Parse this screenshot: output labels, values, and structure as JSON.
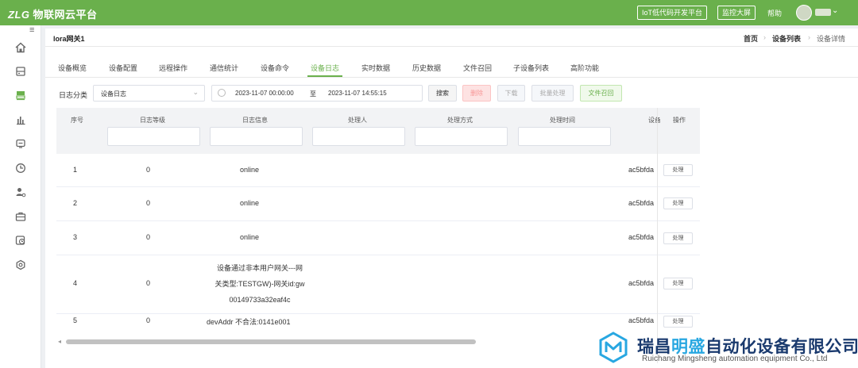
{
  "header": {
    "brand": "ZLG",
    "platform": "物联网云平台",
    "buttons": [
      "IoT低代码开发平台",
      "监控大屏"
    ],
    "help": "帮助"
  },
  "sidebar": {
    "collapse_icon": "hamburger-icon",
    "items": [
      {
        "icon": "home-icon"
      },
      {
        "icon": "device-icon"
      },
      {
        "icon": "gateway-icon",
        "active": true
      },
      {
        "icon": "bar-chart-icon"
      },
      {
        "icon": "message-icon"
      },
      {
        "icon": "clock-icon"
      },
      {
        "icon": "user-settings-icon"
      },
      {
        "icon": "briefcase-icon"
      },
      {
        "icon": "history-icon"
      },
      {
        "icon": "gear-icon"
      }
    ]
  },
  "page": {
    "title": "lora网关1",
    "breadcrumb": [
      "首页",
      "设备列表",
      "设备详情"
    ]
  },
  "tabs": [
    "设备概览",
    "设备配置",
    "远程操作",
    "通信统计",
    "设备命令",
    "设备日志",
    "实时数据",
    "历史数据",
    "文件召回",
    "子设备列表",
    "高阶功能"
  ],
  "active_tab": "设备日志",
  "filters": {
    "label": "日志分类",
    "select_value": "设备日志",
    "start": "2023-11-07 00:00:00",
    "separator": "至",
    "end": "2023-11-07 14:55:15",
    "buttons": {
      "search": "搜索",
      "delete": "删除",
      "download": "下载",
      "batch": "批量处理",
      "recall": "文件召回"
    }
  },
  "table": {
    "columns": [
      "序号",
      "日志等级",
      "日志信息",
      "处理人",
      "处理方式",
      "处理时间",
      "设备",
      "操作"
    ],
    "op_label": "处理",
    "rows": [
      {
        "index": "1",
        "level": "0",
        "info": "online",
        "device": "ac5bfda"
      },
      {
        "index": "2",
        "level": "0",
        "info": "online",
        "device": "ac5bfda"
      },
      {
        "index": "3",
        "level": "0",
        "info": "online",
        "device": "ac5bfda"
      },
      {
        "index": "4",
        "level": "0",
        "info_lines": [
          "设备通过非本用户网关---网",
          "关类型:TESTGW)-网关id:gw",
          "00149733a32eaf4c"
        ],
        "device": "ac5bfda"
      },
      {
        "index": "5",
        "level": "0",
        "info": "devAddr 不合法:0141e001",
        "device": "ac5bfda"
      }
    ]
  },
  "watermark": {
    "name_a": "瑞昌",
    "name_hl": "明盛",
    "name_b": "自动化设备有限公司",
    "english": "Ruichang Mingsheng automation equipment Co., Ltd"
  }
}
